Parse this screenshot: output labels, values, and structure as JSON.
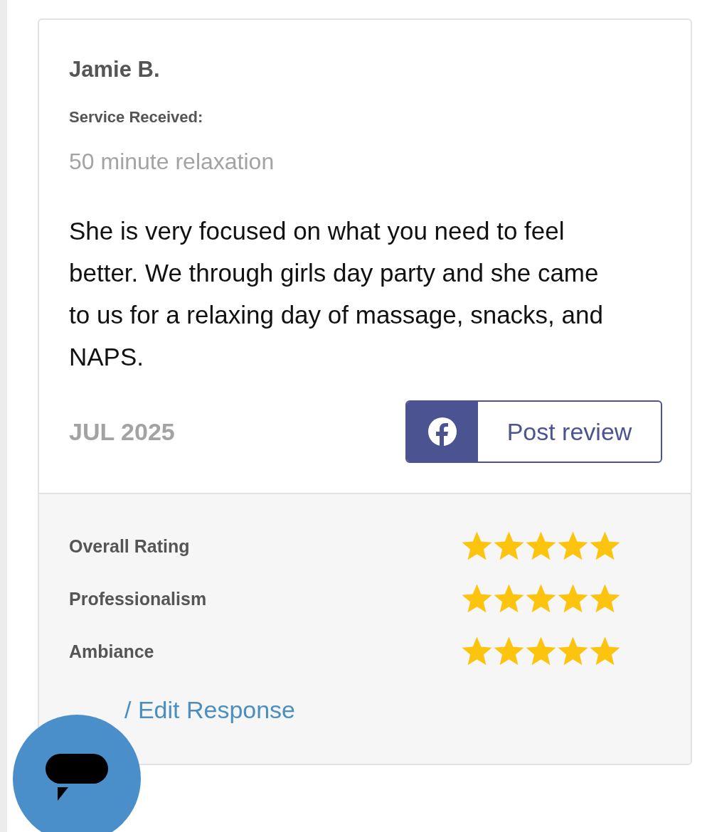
{
  "review": {
    "reviewer": "Jamie B.",
    "service_label": "Service Received:",
    "service": "50 minute relaxation",
    "text": "She is very focused on what you need to feel better. We through girls day party and she came to us for a relaxing day of massage, snacks, and NAPS.",
    "date": "JUL 2025",
    "share_button": "Post review"
  },
  "ratings": [
    {
      "label": "Overall Rating",
      "stars": 5
    },
    {
      "label": "Professionalism",
      "stars": 5
    },
    {
      "label": "Ambiance",
      "stars": 5
    }
  ],
  "response_link": "/ Edit Response"
}
